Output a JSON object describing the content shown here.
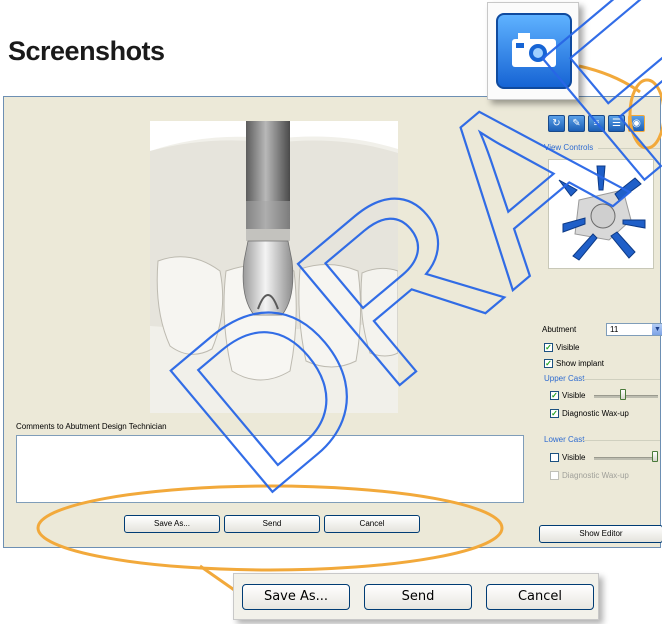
{
  "page": {
    "title": "Screenshots"
  },
  "comments": {
    "label": "Comments to Abutment Design Technician",
    "value": ""
  },
  "actions": {
    "save_as": "Save As...",
    "send": "Send",
    "cancel": "Cancel",
    "show_editor": "Show Editor"
  },
  "toolbar": {
    "icons": [
      "refresh-icon",
      "edit-icon",
      "ruler-icon",
      "document-icon",
      "camera-icon"
    ]
  },
  "side_panel": {
    "view_controls": "View Controls",
    "abutment_label": "Abutment",
    "abutment_value": "11",
    "abutment_visible": "Visible",
    "show_implant": "Show implant",
    "upper_cast": {
      "title": "Upper Cast",
      "visible": "Visible",
      "visible_checked": true,
      "diagnostic": "Diagnostic Wax-up",
      "diagnostic_checked": true,
      "opacity": 0.45
    },
    "lower_cast": {
      "title": "Lower Cast",
      "visible": "Visible",
      "visible_checked": false,
      "diagnostic": "Diagnostic Wax-up",
      "diagnostic_checked": false,
      "opacity": 1.0
    }
  },
  "zoom_buttons": {
    "save_as": "Save As...",
    "send": "Send",
    "cancel": "Cancel"
  },
  "watermark": {
    "text": "DRAFT"
  },
  "colors": {
    "callout": "#f2a93b",
    "accent": "#2e6bd0",
    "window_bg": "#ece9d8",
    "watermark": "#2866e6"
  }
}
